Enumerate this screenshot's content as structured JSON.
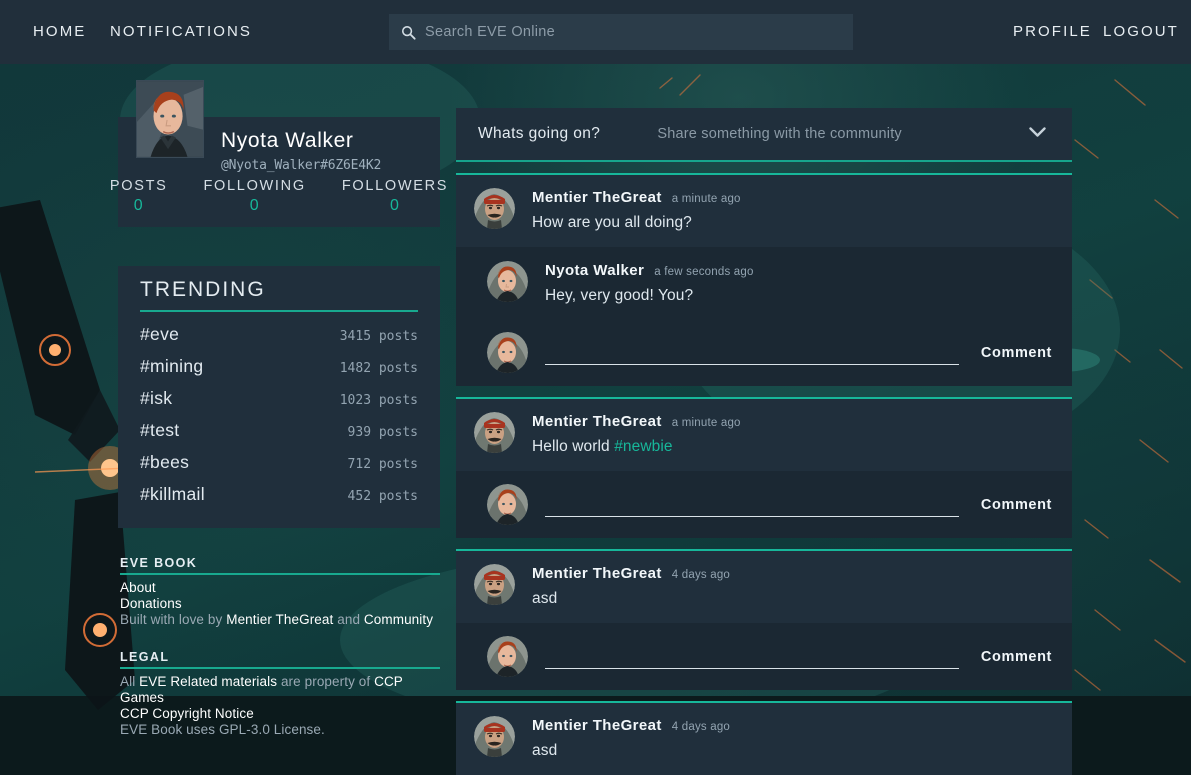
{
  "topnav": {
    "home": "HOME",
    "notifications": "NOTIFICATIONS",
    "profile": "PROFILE",
    "logout": "LOGOUT",
    "search_placeholder": "Search EVE Online",
    "search_value": "",
    "search_icon": "search-icon",
    "bar_color": "#212f3b",
    "search_bg": "#2b3c49"
  },
  "profile": {
    "name": "Nyota Walker",
    "handle": "@Nyota_Walker#6Z6E4K2",
    "avatar_icon": "avatar-nyota-walker",
    "stats": [
      {
        "label": "POSTS",
        "value": "0"
      },
      {
        "label": "FOLLOWING",
        "value": "0"
      },
      {
        "label": "FOLLOWERS",
        "value": "0"
      }
    ],
    "accent_color": "#17b79a"
  },
  "trending": {
    "title": "TRENDING",
    "items": [
      {
        "tag": "#eve",
        "count": "3415 posts"
      },
      {
        "tag": "#mining",
        "count": "1482 posts"
      },
      {
        "tag": "#isk",
        "count": "1023 posts"
      },
      {
        "tag": "#test",
        "count": "939 posts"
      },
      {
        "tag": "#bees",
        "count": "712 posts"
      },
      {
        "tag": "#killmail",
        "count": "452 posts"
      }
    ]
  },
  "footer": {
    "evebook_heading": "EVE BOOK",
    "about": "About",
    "donations": "Donations",
    "built_prefix": "Built with love by",
    "built_author": "Mentier TheGreat",
    "built_and": "and",
    "built_community": "Community",
    "legal_heading": "LEGAL",
    "legal_all": "All",
    "legal_eve_materials": "EVE Related materials",
    "legal_property_of": "are property of",
    "legal_ccp_games": "CCP Games",
    "legal_copyright_notice": "CCP Copyright Notice",
    "legal_license": "EVE Book uses GPL-3.0 License."
  },
  "composer": {
    "title": "Whats going on?",
    "placeholder": "Share something with the community",
    "chevron_icon": "chevron-down-icon"
  },
  "feed": {
    "comment_button_label": "Comment",
    "comment_placeholder": "",
    "posts": [
      {
        "author": "Mentier TheGreat",
        "avatar_icon": "avatar-mentier-thegreat",
        "time": "a minute ago",
        "text": "How are you all doing?",
        "hashtag": "",
        "replies": [
          {
            "author": "Nyota Walker",
            "avatar_icon": "avatar-nyota-walker",
            "time": "a few seconds ago",
            "text": "Hey, very good! You?"
          }
        ],
        "has_comment_box": true
      },
      {
        "author": "Mentier TheGreat",
        "avatar_icon": "avatar-mentier-thegreat",
        "time": "a minute ago",
        "text": "Hello world",
        "hashtag": "#newbie",
        "replies": [],
        "has_comment_box": true
      },
      {
        "author": "Mentier TheGreat",
        "avatar_icon": "avatar-mentier-thegreat",
        "time": "4 days ago",
        "text": "asd",
        "hashtag": "",
        "replies": [],
        "has_comment_box": true
      },
      {
        "author": "Mentier TheGreat",
        "avatar_icon": "avatar-mentier-thegreat",
        "time": "4 days ago",
        "text": "asd",
        "hashtag": "",
        "replies": [],
        "has_comment_box": false
      }
    ]
  }
}
